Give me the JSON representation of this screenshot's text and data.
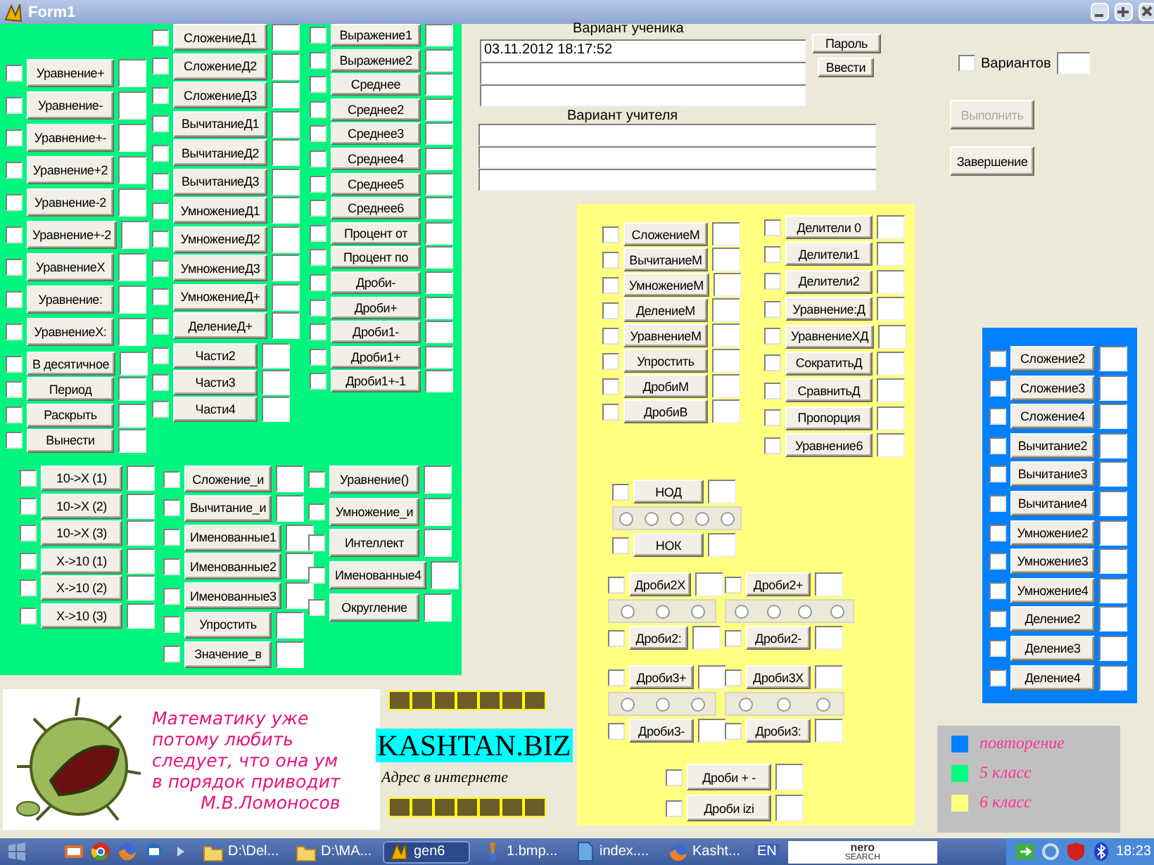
{
  "window": {
    "title": "Form1"
  },
  "green_panel": {
    "blocks": [
      {
        "items": [
          {
            "kind": "row",
            "label": "Уравнение+",
            "checked": false
          },
          {
            "kind": "row",
            "label": "Уравнение-",
            "checked": false
          },
          {
            "kind": "row",
            "label": "Уравнение+-",
            "checked": false
          },
          {
            "kind": "row",
            "label": "Уравнение+2",
            "checked": false
          },
          {
            "kind": "row",
            "label": "Уравнение-2",
            "checked": false
          },
          {
            "kind": "row",
            "label": "Уравнение+-2",
            "checked": false
          },
          {
            "kind": "row",
            "label": "УравнениеX",
            "checked": false
          },
          {
            "kind": "row",
            "label": "Уравнение:",
            "checked": false
          },
          {
            "kind": "row",
            "label": "УравнениеX:",
            "checked": false
          }
        ]
      },
      {
        "items": [
          {
            "kind": "row",
            "label": "В десятичное",
            "checked": false
          },
          {
            "kind": "row",
            "label": "Период",
            "checked": false
          },
          {
            "kind": "row",
            "label": "Раскрыть",
            "checked": false
          },
          {
            "kind": "row",
            "label": "Вынести",
            "checked": false
          }
        ]
      },
      {
        "items": [
          {
            "kind": "row",
            "label": "СложениеД1",
            "checked": false
          },
          {
            "kind": "row",
            "label": "СложениеД2",
            "checked": false
          },
          {
            "kind": "row",
            "label": "СложениеД3",
            "checked": false
          },
          {
            "kind": "row",
            "label": "ВычитаниеД1",
            "checked": false
          },
          {
            "kind": "row",
            "label": "ВычитаниеД2",
            "checked": false
          },
          {
            "kind": "row",
            "label": "ВычитаниеД3",
            "checked": false
          },
          {
            "kind": "row",
            "label": "УмножениеД1",
            "checked": false
          },
          {
            "kind": "row",
            "label": "УмножениеД2",
            "checked": false
          },
          {
            "kind": "row",
            "label": "УмножениеД3",
            "checked": false
          },
          {
            "kind": "row",
            "label": "УмножениеД+",
            "checked": false
          },
          {
            "kind": "row",
            "label": "ДелениеД+",
            "checked": false
          }
        ]
      },
      {
        "items": [
          {
            "kind": "row",
            "label": "Части2",
            "checked": false
          },
          {
            "kind": "row",
            "label": "Части3",
            "checked": false
          },
          {
            "kind": "row",
            "label": "Части4",
            "checked": false
          }
        ]
      },
      {
        "items": [
          {
            "kind": "row",
            "label": "Выражение1",
            "checked": false
          },
          {
            "kind": "row",
            "label": "Выражение2",
            "checked": false
          },
          {
            "kind": "row",
            "label": "Среднее",
            "checked": false
          },
          {
            "kind": "row",
            "label": "Среднее2",
            "checked": false
          },
          {
            "kind": "row",
            "label": "Среднее3",
            "checked": false
          },
          {
            "kind": "row",
            "label": "Среднее4",
            "checked": false
          },
          {
            "kind": "row",
            "label": "Среднее5",
            "checked": false
          },
          {
            "kind": "row",
            "label": "Среднее6",
            "checked": false
          },
          {
            "kind": "row",
            "label": "Процент от",
            "checked": false
          },
          {
            "kind": "row",
            "label": "Процент по",
            "checked": false
          },
          {
            "kind": "row",
            "label": "Дроби-",
            "checked": false
          },
          {
            "kind": "row",
            "label": "Дроби+",
            "checked": false
          },
          {
            "kind": "row",
            "label": "Дроби1-",
            "checked": false
          },
          {
            "kind": "row",
            "label": "Дроби1+",
            "checked": false
          },
          {
            "kind": "row",
            "label": "Дроби1+-1",
            "checked": false
          }
        ]
      },
      {
        "items": [
          {
            "kind": "row",
            "label": "10->X (1)",
            "checked": false
          },
          {
            "kind": "row",
            "label": "10->X (2)",
            "checked": false
          },
          {
            "kind": "row",
            "label": "10->X (3)",
            "checked": false
          },
          {
            "kind": "row",
            "label": "X->10 (1)",
            "checked": false
          },
          {
            "kind": "row",
            "label": "X->10 (2)",
            "checked": false
          },
          {
            "kind": "row",
            "label": "X->10 (3)",
            "checked": false
          }
        ]
      },
      {
        "items": [
          {
            "kind": "row",
            "label": "Сложение_и",
            "checked": false
          },
          {
            "kind": "row",
            "label": "Вычитание_и",
            "checked": false
          },
          {
            "kind": "row",
            "label": "Именованные1",
            "checked": false
          },
          {
            "kind": "row",
            "label": "Именованные2",
            "checked": false
          },
          {
            "kind": "row",
            "label": "Именованные3",
            "checked": false
          },
          {
            "kind": "row",
            "label": "Упростить",
            "checked": false
          },
          {
            "kind": "row",
            "label": "Значение_в",
            "checked": false
          }
        ]
      },
      {
        "items": [
          {
            "kind": "row",
            "label": "Уравнение()",
            "checked": false
          },
          {
            "kind": "row",
            "label": "Умножение_и",
            "checked": false
          },
          {
            "kind": "row",
            "label": "Интеллект",
            "checked": false
          },
          {
            "kind": "row",
            "label": "Именованные4",
            "checked": false
          },
          {
            "kind": "row",
            "label": "Округление",
            "checked": false
          }
        ]
      }
    ]
  },
  "student_variant": {
    "label": "Вариант ученика",
    "value": "03.11.2012 18:17:52"
  },
  "teacher_variant": {
    "label": "Вариант учителя"
  },
  "buttons": [
    {
      "label": "Пароль",
      "disabled": false
    },
    {
      "label": "Ввести",
      "disabled": false
    },
    {
      "label": "Выполнить",
      "disabled": true
    },
    {
      "label": "Завершение",
      "disabled": false
    }
  ],
  "variants": {
    "label": "Вариантов",
    "checked": false
  },
  "yellow_panel": {
    "blocks": [
      {
        "items": [
          {
            "kind": "row",
            "label": "СложениеМ",
            "checked": false
          },
          {
            "kind": "row",
            "label": "ВычитаниеМ",
            "checked": false
          },
          {
            "kind": "row",
            "label": "УмножениеМ",
            "checked": false
          },
          {
            "kind": "row",
            "label": "ДелениеМ",
            "checked": false
          },
          {
            "kind": "row",
            "label": "УравнениеМ",
            "checked": false
          },
          {
            "kind": "row",
            "label": "Упростить",
            "checked": false
          },
          {
            "kind": "row",
            "label": "ДробиМ",
            "checked": false
          },
          {
            "kind": "row",
            "label": "ДробиВ",
            "checked": false
          }
        ]
      },
      {
        "items": [
          {
            "kind": "row",
            "label": "Делители 0",
            "checked": false
          },
          {
            "kind": "row",
            "label": "Делители1",
            "checked": false
          },
          {
            "kind": "row",
            "label": "Делители2",
            "checked": false
          },
          {
            "kind": "row",
            "label": "Уравнение:Д",
            "checked": false
          },
          {
            "kind": "row",
            "label": "УравнениеХД",
            "checked": false
          },
          {
            "kind": "row",
            "label": "СократитьД",
            "checked": false
          },
          {
            "kind": "row",
            "label": "СравнитьД",
            "checked": false
          },
          {
            "kind": "row",
            "label": "Пропорция",
            "checked": false
          },
          {
            "kind": "row",
            "label": "Уравнение6",
            "checked": false
          }
        ]
      },
      {
        "items": [
          {
            "kind": "row",
            "label": "НОД",
            "checked": false
          },
          {
            "kind": "radios",
            "options": [
              {
                "selected": false
              },
              {
                "selected": false
              },
              {
                "selected": false
              },
              {
                "selected": false
              },
              {
                "selected": false
              }
            ]
          },
          {
            "kind": "row",
            "label": "НОК",
            "checked": false
          }
        ]
      },
      {
        "items": [
          {
            "kind": "row",
            "label": "Дроби2X",
            "checked": false
          },
          {
            "kind": "radios",
            "options": [
              {
                "selected": false
              },
              {
                "selected": false
              },
              {
                "selected": false
              }
            ]
          },
          {
            "kind": "row",
            "label": "Дроби2:",
            "checked": false
          }
        ]
      },
      {
        "items": [
          {
            "kind": "row",
            "label": "Дроби2+",
            "checked": false
          },
          {
            "kind": "radios",
            "options": [
              {
                "selected": false
              },
              {
                "selected": false
              },
              {
                "selected": false
              },
              {
                "selected": false
              }
            ]
          },
          {
            "kind": "row",
            "label": "Дроби2-",
            "checked": false
          }
        ]
      },
      {
        "items": [
          {
            "kind": "row",
            "label": "Дроби3+",
            "checked": false
          },
          {
            "kind": "radios",
            "options": [
              {
                "selected": false
              },
              {
                "selected": false
              },
              {
                "selected": false
              }
            ]
          },
          {
            "kind": "row",
            "label": "Дроби3-",
            "checked": false
          }
        ]
      },
      {
        "items": [
          {
            "kind": "row",
            "label": "Дроби3X",
            "checked": false
          },
          {
            "kind": "radios",
            "options": [
              {
                "selected": false
              },
              {
                "selected": false
              },
              {
                "selected": false
              }
            ]
          },
          {
            "kind": "row",
            "label": "Дроби3:",
            "checked": false
          }
        ]
      },
      {
        "items": [
          {
            "kind": "row",
            "label": "Дроби + -",
            "checked": false
          },
          {
            "kind": "row",
            "label": "Дроби izi",
            "checked": false
          }
        ]
      }
    ]
  },
  "blue_panel": {
    "blocks": [
      {
        "items": [
          {
            "kind": "row",
            "label": "Сложение2",
            "checked": false
          },
          {
            "kind": "row",
            "label": "Сложение3",
            "checked": false
          },
          {
            "kind": "row",
            "label": "Сложение4",
            "checked": false
          },
          {
            "kind": "row",
            "label": "Вычитание2",
            "checked": false
          },
          {
            "kind": "row",
            "label": "Вычитание3",
            "checked": false
          },
          {
            "kind": "row",
            "label": "Вычитание4",
            "checked": false
          },
          {
            "kind": "row",
            "label": "Умножение2",
            "checked": false
          },
          {
            "kind": "row",
            "label": "Умножение3",
            "checked": false
          },
          {
            "kind": "row",
            "label": "Умножение4",
            "checked": false
          },
          {
            "kind": "row",
            "label": "Деление2",
            "checked": false
          },
          {
            "kind": "row",
            "label": "Деление3",
            "checked": false
          },
          {
            "kind": "row",
            "label": "Деление4",
            "checked": false
          }
        ]
      }
    ]
  },
  "quote": {
    "lines": [
      "Математику уже",
      "потому любить",
      "следует, что она ум",
      "в порядок приводит"
    ],
    "author": "М.В.Ломоносов"
  },
  "site": {
    "name": "KASHTAN.BIZ",
    "caption": "Адрес в интернете"
  },
  "legend": {
    "items": [
      {
        "label": "повторение",
        "color": "#0080ff"
      },
      {
        "label": "5 класс",
        "color": "#00ff80"
      },
      {
        "label": "6 класс",
        "color": "#ffff80"
      }
    ]
  },
  "taskbar": {
    "buttons": [
      {
        "kind": "folder",
        "label": "D:\\Del...",
        "selected": false
      },
      {
        "kind": "folder",
        "label": "D:\\MA...",
        "selected": false
      },
      {
        "kind": "app",
        "label": "gen6",
        "selected": true
      },
      {
        "kind": "image",
        "label": "1.bmp...",
        "selected": false
      },
      {
        "kind": "document",
        "label": "index....",
        "selected": false
      },
      {
        "kind": "browser",
        "label": "Kasht...",
        "selected": false
      }
    ],
    "language": "EN",
    "search_logo": "nero",
    "search_sublogo": "SEARCH",
    "clock": "18:23"
  }
}
